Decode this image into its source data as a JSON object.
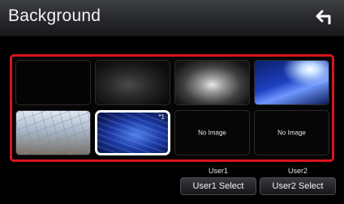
{
  "header": {
    "title": "Background",
    "back_icon": "back-arrow-icon"
  },
  "thumbnails": [
    {
      "name": "background-dark",
      "caption": ""
    },
    {
      "name": "background-smoke",
      "caption": ""
    },
    {
      "name": "background-glow",
      "caption": ""
    },
    {
      "name": "background-blue-sky",
      "caption": ""
    },
    {
      "name": "background-floor",
      "caption": ""
    },
    {
      "name": "background-blue-rays",
      "caption": "",
      "mark": "*1",
      "selected": true
    },
    {
      "name": "user1-slot",
      "caption": "No Image"
    },
    {
      "name": "user2-slot",
      "caption": "No Image"
    }
  ],
  "user_slots": [
    {
      "label": "User1",
      "button": "User1 Select"
    },
    {
      "label": "User2",
      "button": "User2 Select"
    }
  ],
  "colors": {
    "highlight_frame": "#d8141e",
    "selected_border": "#ffffff"
  }
}
